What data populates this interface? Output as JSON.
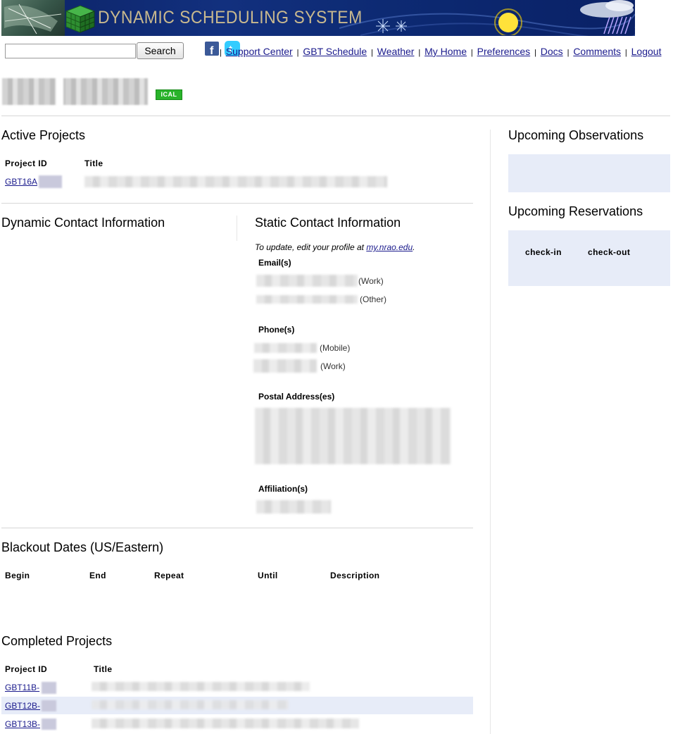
{
  "banner": {
    "title": "DYNAMIC SCHEDULING SYSTEM"
  },
  "search": {
    "value": "",
    "button_label": "Search"
  },
  "social": {
    "facebook": "facebook-icon",
    "twitter": "twitter-icon"
  },
  "nav": {
    "separator": "|",
    "links": [
      "Support Center",
      "GBT Schedule",
      "Weather",
      "My Home",
      "Preferences",
      "Docs",
      "Comments",
      "Logout"
    ]
  },
  "user": {
    "ical_badge": "ICAL"
  },
  "active_projects": {
    "heading": "Active Projects",
    "columns": [
      "Project ID",
      "Title"
    ],
    "rows": [
      {
        "id": "GBT16A"
      }
    ]
  },
  "dynamic_contact": {
    "heading": "Dynamic Contact Information"
  },
  "static_contact": {
    "heading": "Static Contact Information",
    "note_prefix": "To update, edit your profile at ",
    "note_link": "my.nrao.edu",
    "note_suffix": ".",
    "emails_label": "Email(s)",
    "emails": [
      "(Work)",
      "(Other)"
    ],
    "phones_label": "Phone(s)",
    "phones": [
      "(Mobile)",
      "(Work)"
    ],
    "postal_label": "Postal Address(es)",
    "affiliation_label": "Affiliation(s)"
  },
  "blackout": {
    "heading": "Blackout Dates (US/Eastern)",
    "columns": [
      "Begin",
      "End",
      "Repeat",
      "Until",
      "Description"
    ]
  },
  "completed_projects": {
    "heading": "Completed Projects",
    "columns": [
      "Project ID",
      "Title"
    ],
    "rows": [
      {
        "id": "GBT11B-"
      },
      {
        "id": "GBT12B-"
      },
      {
        "id": "GBT13B-"
      }
    ]
  },
  "upcoming_observations": {
    "heading": "Upcoming Observations"
  },
  "upcoming_reservations": {
    "heading": "Upcoming Reservations",
    "columns": [
      "check-in",
      "check-out"
    ]
  },
  "colors": {
    "panel": "#e7ecf8",
    "link": "#1a1a8c",
    "ical": "#29b32a",
    "banner": "#12307e"
  }
}
